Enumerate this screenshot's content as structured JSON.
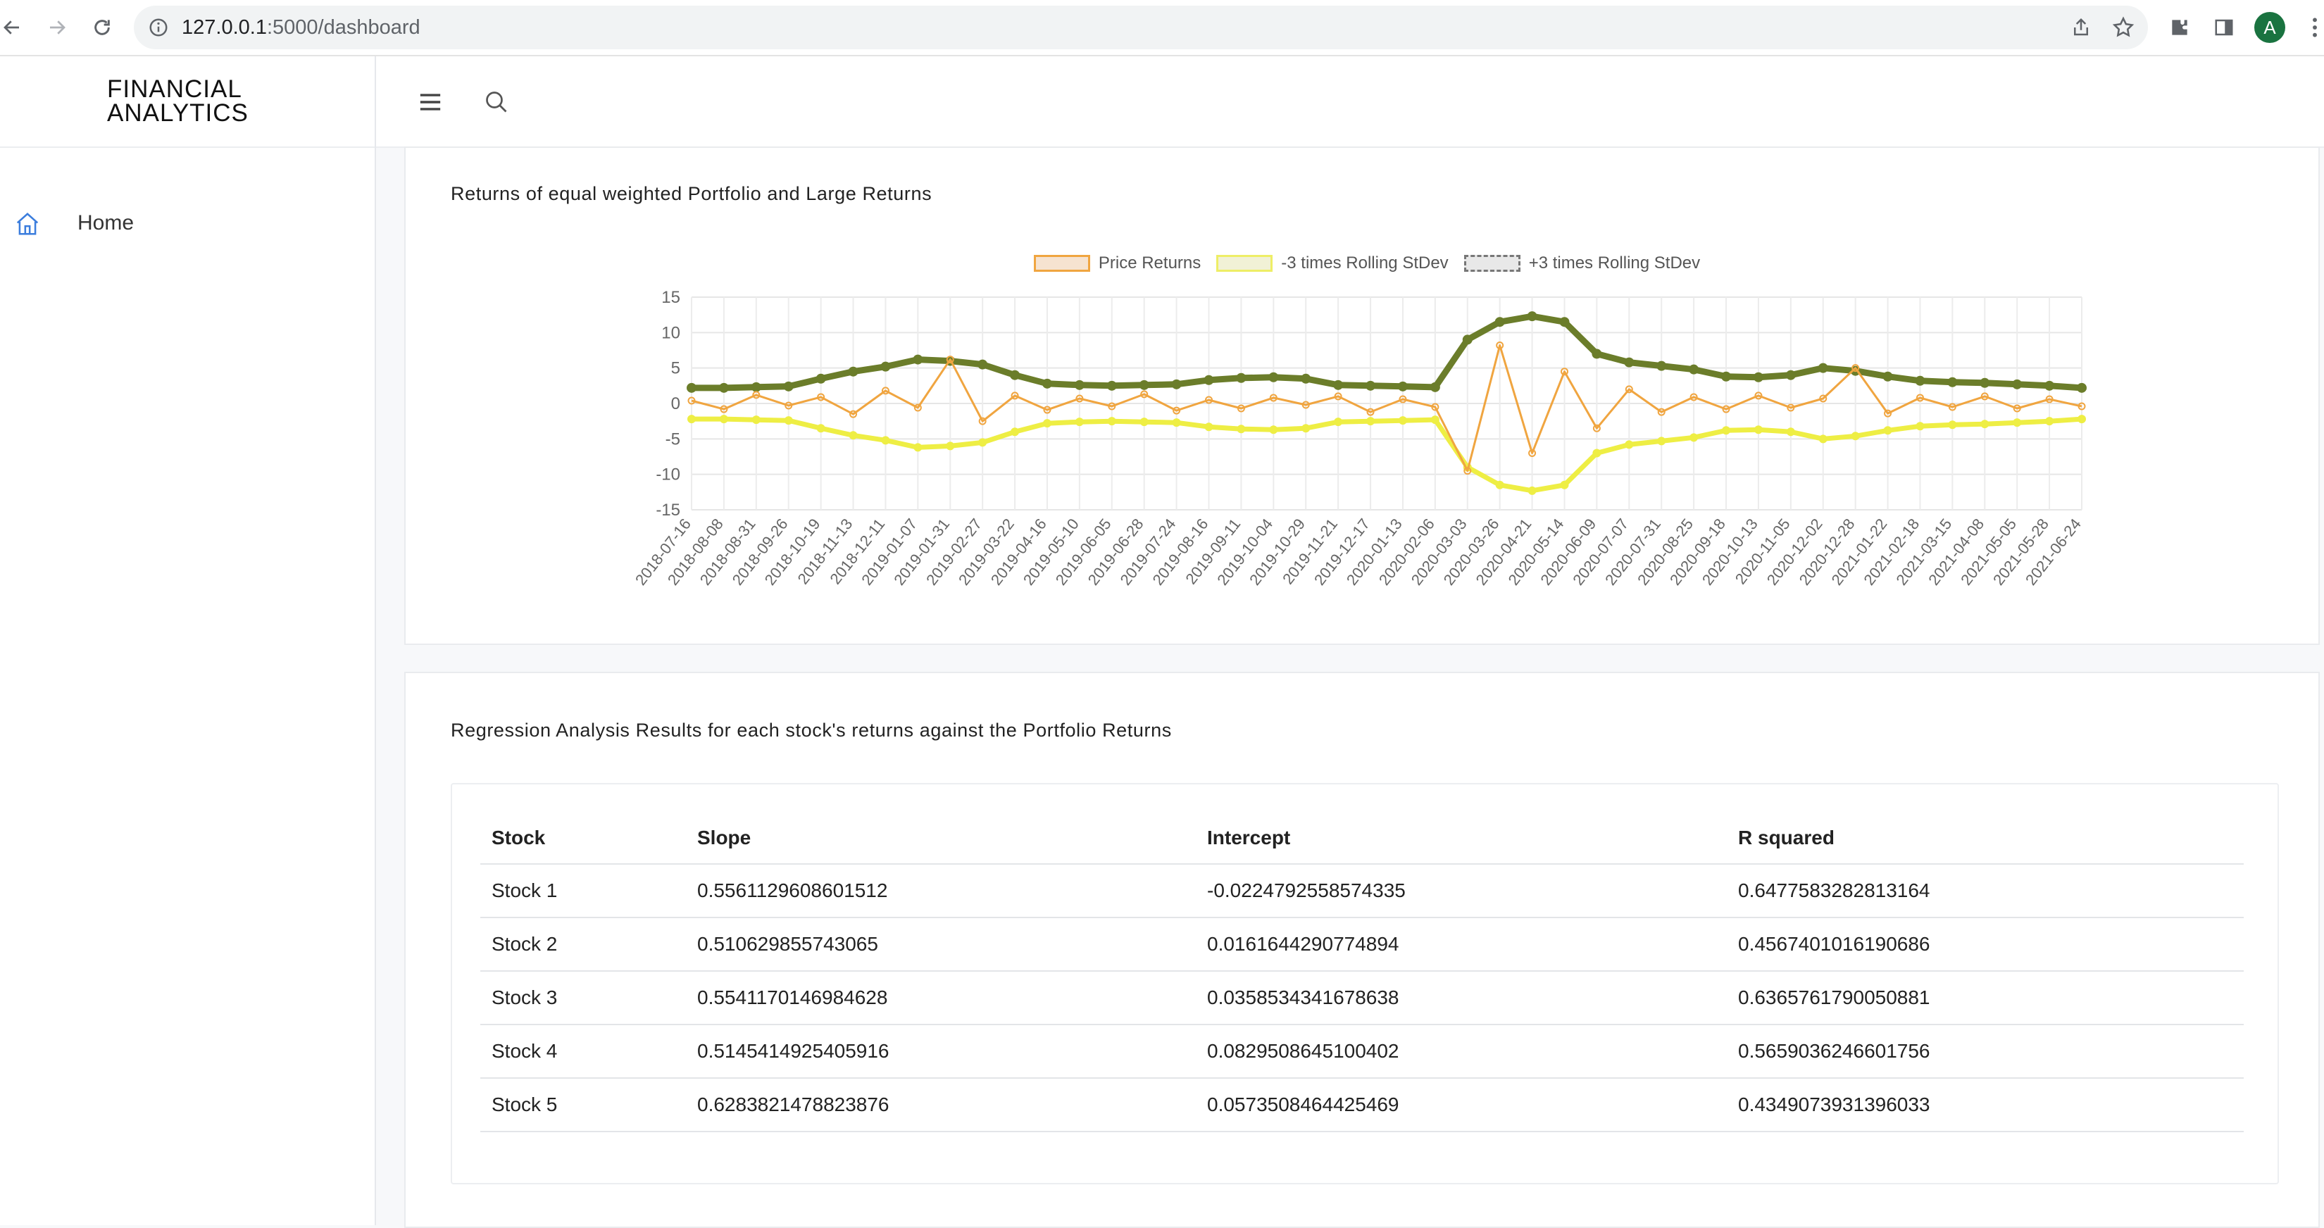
{
  "browser": {
    "url_host": "127.0.0.1",
    "url_path": ":5000/dashboard",
    "avatar_letter": "A"
  },
  "sidebar": {
    "brand_line1": "FINANCIAL",
    "brand_line2": "ANALYTICS",
    "nav_home": "Home",
    "accent_color": "#3b7ddd"
  },
  "chart_card": {
    "title": "Returns of equal weighted Portfolio and Large Returns"
  },
  "chart_data": {
    "type": "line",
    "y_ticks": [
      15,
      10,
      5,
      0,
      -5,
      -10,
      -15
    ],
    "ylim": [
      -15,
      15
    ],
    "x_ticks": [
      "2018-07-16",
      "2018-08-08",
      "2018-08-31",
      "2018-09-26",
      "2018-10-19",
      "2018-11-13",
      "2018-12-11",
      "2019-01-07",
      "2019-01-31",
      "2019-02-27",
      "2019-03-22",
      "2019-04-16",
      "2019-05-10",
      "2019-06-05",
      "2019-06-28",
      "2019-07-24",
      "2019-08-16",
      "2019-09-11",
      "2019-10-04",
      "2019-10-29",
      "2019-11-21",
      "2019-12-17",
      "2020-01-13",
      "2020-02-06",
      "2020-03-03",
      "2020-03-26",
      "2020-04-21",
      "2020-05-14",
      "2020-06-09",
      "2020-07-07",
      "2020-07-31",
      "2020-08-25",
      "2020-09-18",
      "2020-10-13",
      "2020-11-05",
      "2020-12-02",
      "2020-12-28",
      "2021-01-22",
      "2021-02-18",
      "2021-03-15",
      "2021-04-08",
      "2021-05-05",
      "2021-05-28",
      "2021-06-24"
    ],
    "grid": true,
    "legend_position": "top",
    "series": [
      {
        "name": "Price Returns",
        "color": "#f0a540",
        "values": [
          0.4,
          -0.8,
          1.2,
          -0.3,
          0.9,
          -1.5,
          1.8,
          -0.6,
          6.2,
          -2.5,
          1.1,
          -0.9,
          0.7,
          -0.4,
          1.3,
          -1.0,
          0.5,
          -0.7,
          0.8,
          -0.2,
          1.0,
          -1.2,
          0.6,
          -0.5,
          -9.5,
          8.2,
          -7.0,
          4.5,
          -3.5,
          2.0,
          -1.2,
          0.9,
          -0.8,
          1.1,
          -0.6,
          0.7,
          5.0,
          -1.4,
          0.8,
          -0.5,
          1.0,
          -0.7,
          0.6,
          -0.4
        ]
      },
      {
        "name": "-3 times Rolling StDev",
        "color": "#eeee44",
        "values": [
          -2.2,
          -2.2,
          -2.3,
          -2.4,
          -3.5,
          -4.5,
          -5.2,
          -6.2,
          -6.0,
          -5.5,
          -4.0,
          -2.8,
          -2.6,
          -2.5,
          -2.6,
          -2.7,
          -3.3,
          -3.6,
          -3.7,
          -3.5,
          -2.6,
          -2.5,
          -2.4,
          -2.3,
          -9.0,
          -11.5,
          -12.3,
          -11.5,
          -7.0,
          -5.8,
          -5.3,
          -4.8,
          -3.8,
          -3.7,
          -4.0,
          -5.0,
          -4.6,
          -3.8,
          -3.2,
          -3.0,
          -2.9,
          -2.7,
          -2.5,
          -2.2
        ]
      },
      {
        "name": "+3 times Rolling StDev",
        "color": "#6b7d2a",
        "values": [
          2.2,
          2.2,
          2.3,
          2.4,
          3.5,
          4.5,
          5.2,
          6.2,
          6.0,
          5.5,
          4.0,
          2.8,
          2.6,
          2.5,
          2.6,
          2.7,
          3.3,
          3.6,
          3.7,
          3.5,
          2.6,
          2.5,
          2.4,
          2.3,
          9.0,
          11.5,
          12.3,
          11.5,
          7.0,
          5.8,
          5.3,
          4.8,
          3.8,
          3.7,
          4.0,
          5.0,
          4.6,
          3.8,
          3.2,
          3.0,
          2.9,
          2.7,
          2.5,
          2.2
        ]
      }
    ]
  },
  "table_card": {
    "title": "Regression Analysis Results for each stock's returns against the Portfolio Returns",
    "columns": [
      "Stock",
      "Slope",
      "Intercept",
      "R squared"
    ],
    "rows": [
      [
        "Stock 1",
        "0.5561129608601512",
        "-0.0224792558574335",
        "0.6477583282813164"
      ],
      [
        "Stock 2",
        "0.510629855743065",
        "0.0161644290774894",
        "0.4567401016190686"
      ],
      [
        "Stock 3",
        "0.5541170146984628",
        "0.0358534341678638",
        "0.6365761790050881"
      ],
      [
        "Stock 4",
        "0.5145414925405916",
        "0.0829508645100402",
        "0.5659036246601756"
      ],
      [
        "Stock 5",
        "0.6283821478823876",
        "0.0573508464425469",
        "0.4349073931396033"
      ]
    ]
  }
}
